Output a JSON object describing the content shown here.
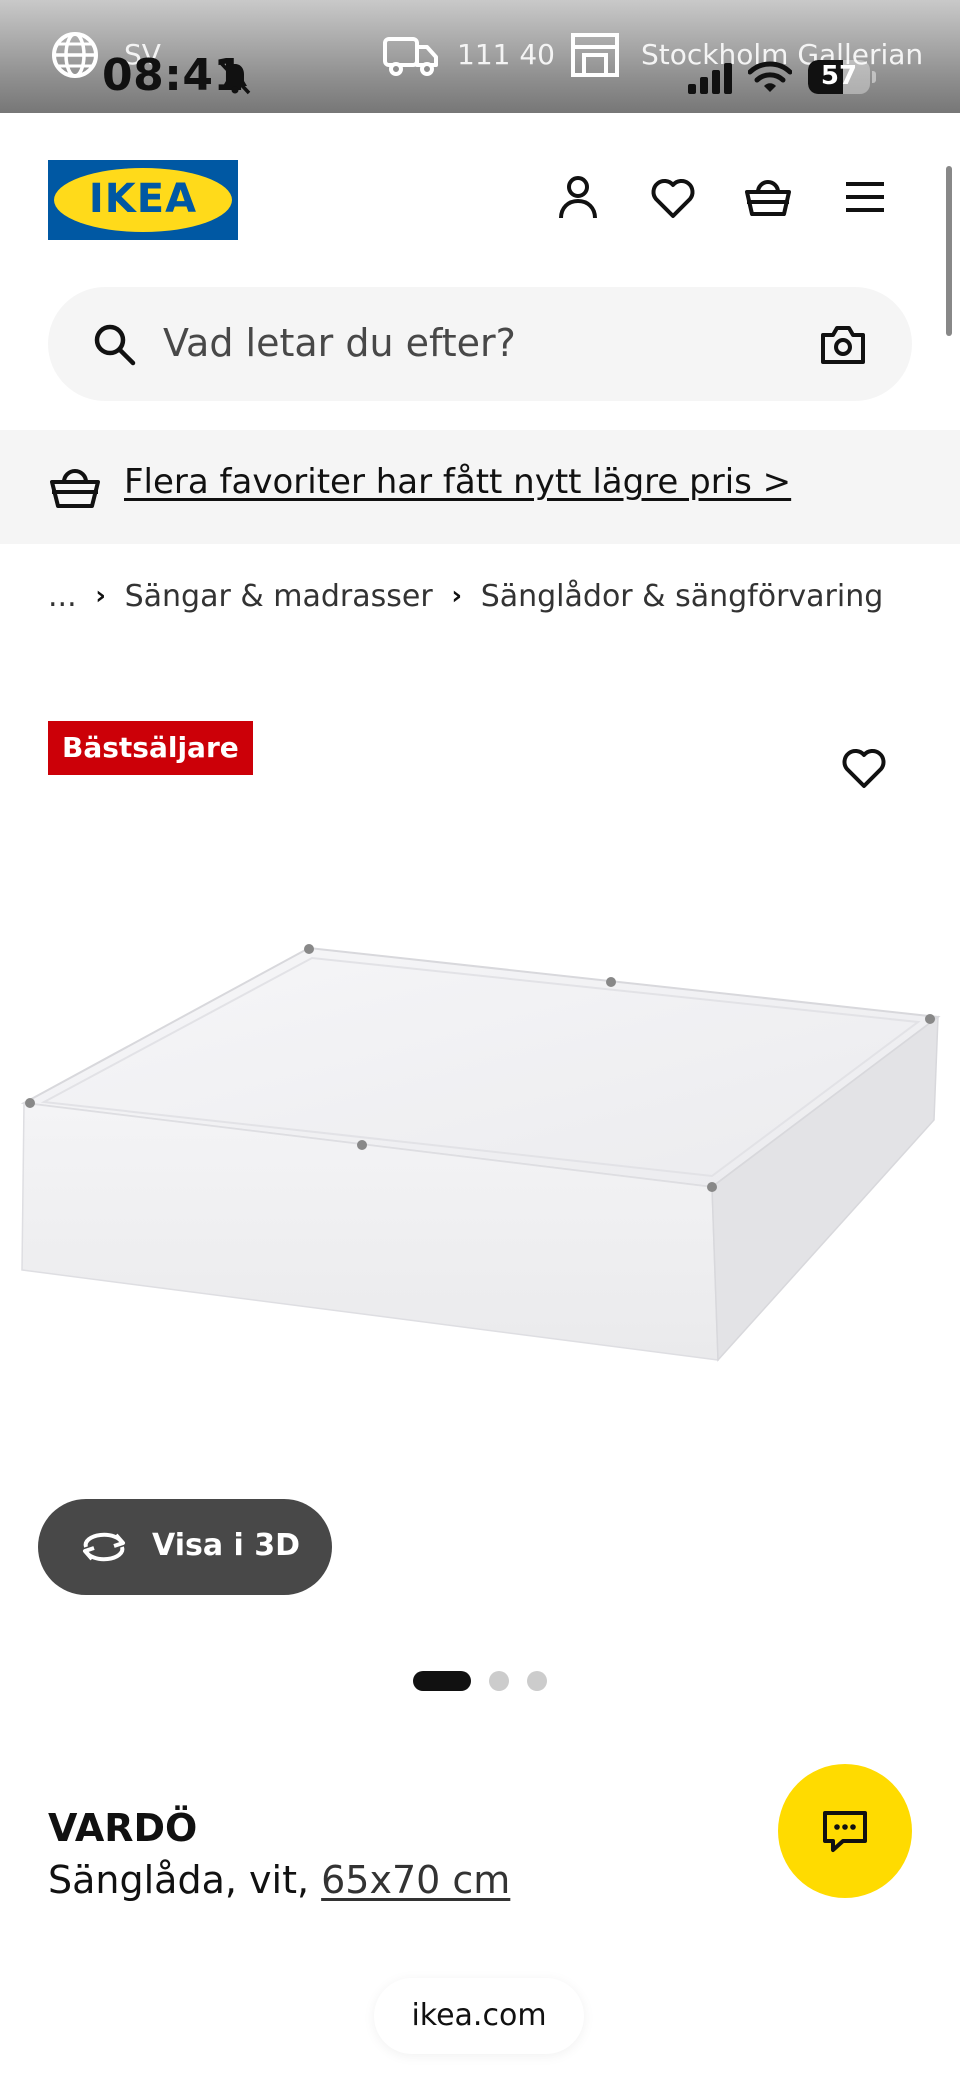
{
  "status_bar": {
    "language": "SV",
    "time": "08:41",
    "postal_code": "111 40",
    "store_name": "Stockholm Gallerian",
    "battery_level": "57",
    "battery_fraction": 0.57
  },
  "header": {
    "logo_text": "IKEA",
    "icons": [
      "user-icon",
      "heart-icon",
      "basket-icon",
      "menu-icon"
    ]
  },
  "search": {
    "placeholder": "Vad letar du efter?"
  },
  "promo": {
    "text": "Flera favoriter har fått nytt lägre pris >"
  },
  "breadcrumb": {
    "items": [
      "...",
      "Sängar & madrasser",
      "Sänglådor & sängförvaring"
    ]
  },
  "product": {
    "badge": "Bästsäljare",
    "view_3d_label": "Visa i 3D",
    "name": "VARDÖ",
    "description_prefix": "Sänglåda, vit, ",
    "size": "65x70 cm",
    "image_count": 3,
    "active_image_index": 0
  },
  "browser": {
    "url": "ikea.com"
  },
  "colors": {
    "ikea_blue": "#0058a3",
    "ikea_yellow": "#ffda1a",
    "badge_red": "#cc0008",
    "chat_yellow": "#ffdb00"
  }
}
